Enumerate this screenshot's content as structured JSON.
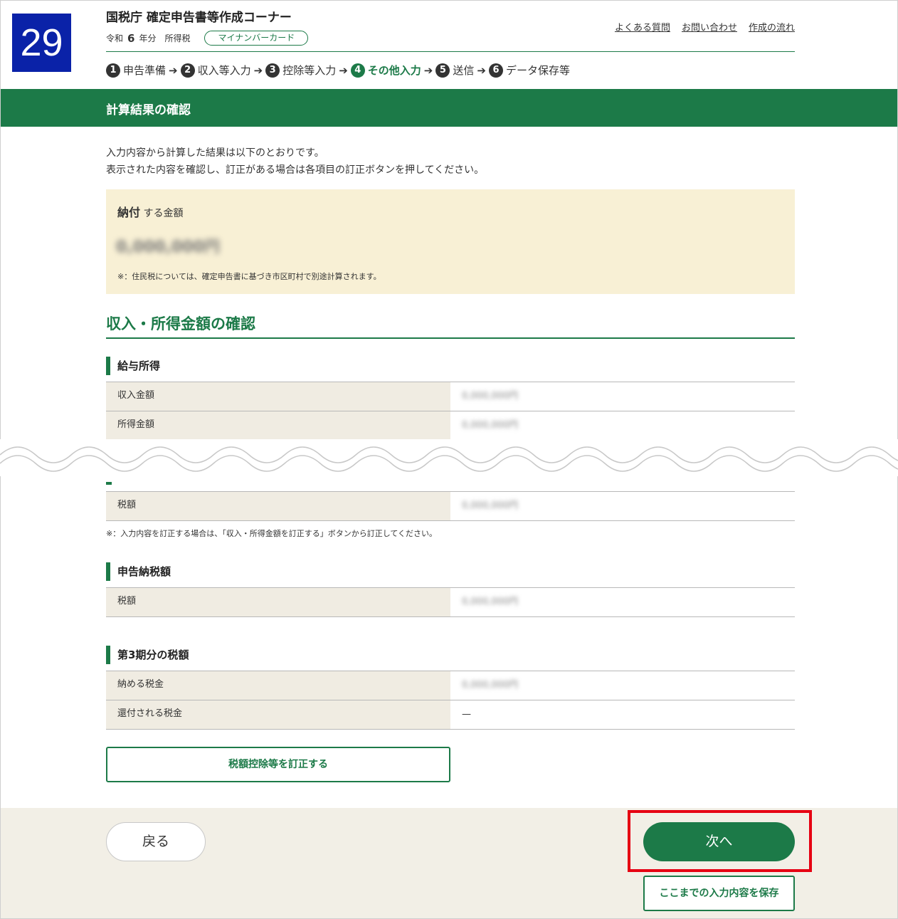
{
  "step_number": "29",
  "header": {
    "title": "国税庁 確定申告書等作成コーナー",
    "era": "令和",
    "year": "6",
    "year_suffix": "年分",
    "tax_type": "所得税",
    "card_badge": "マイナンバーカード",
    "links": [
      "よくある質問",
      "お問い合わせ",
      "作成の流れ"
    ]
  },
  "progress": {
    "steps": [
      {
        "num": "1",
        "label": "申告準備"
      },
      {
        "num": "2",
        "label": "収入等入力"
      },
      {
        "num": "3",
        "label": "控除等入力"
      },
      {
        "num": "4",
        "label": "その他入力"
      },
      {
        "num": "5",
        "label": "送信"
      },
      {
        "num": "6",
        "label": "データ保存等"
      }
    ],
    "active_step": 4,
    "arrow": "➔"
  },
  "page_heading": "計算結果の確認",
  "intro": {
    "line1": "入力内容から計算した結果は以下のとおりです。",
    "line2": "表示された内容を確認し、訂正がある場合は各項目の訂正ボタンを押してください。"
  },
  "payment": {
    "label_bold": "納付",
    "label_rest": " する金額",
    "amount": "0,000,000円",
    "note": "※：住民税については、確定申告書に基づき市区町村で別途計算されます。"
  },
  "income_section": {
    "title": "収入・所得金額の確認",
    "salary": {
      "heading": "給与所得",
      "rows": [
        {
          "label": "収入金額",
          "value": "0,000,000円"
        },
        {
          "label": "所得金額",
          "value": "0,000,000円"
        }
      ]
    },
    "tax": {
      "rows": [
        {
          "label": "税額",
          "value": "0,000,000円"
        }
      ]
    },
    "note": "※：入力内容を訂正する場合は、「収入・所得金額を訂正する」ボタンから訂正してください。"
  },
  "declared_tax": {
    "heading": "申告納税額",
    "rows": [
      {
        "label": "税額",
        "value": "0,000,000円"
      }
    ]
  },
  "third_period": {
    "heading": "第3期分の税額",
    "rows": [
      {
        "label": "納める税金",
        "value": "0,000,000円"
      },
      {
        "label": "還付される税金",
        "value": "—"
      }
    ]
  },
  "buttons": {
    "fix_tax": "税額控除等を訂正する",
    "back": "戻る",
    "next": "次へ",
    "save": "ここまでの入力内容を保存"
  },
  "colors": {
    "brand_green": "#1c7a48",
    "badge_blue": "#0a22a8",
    "highlight_red": "#e60012",
    "pay_box_bg": "#f8f0d5"
  }
}
